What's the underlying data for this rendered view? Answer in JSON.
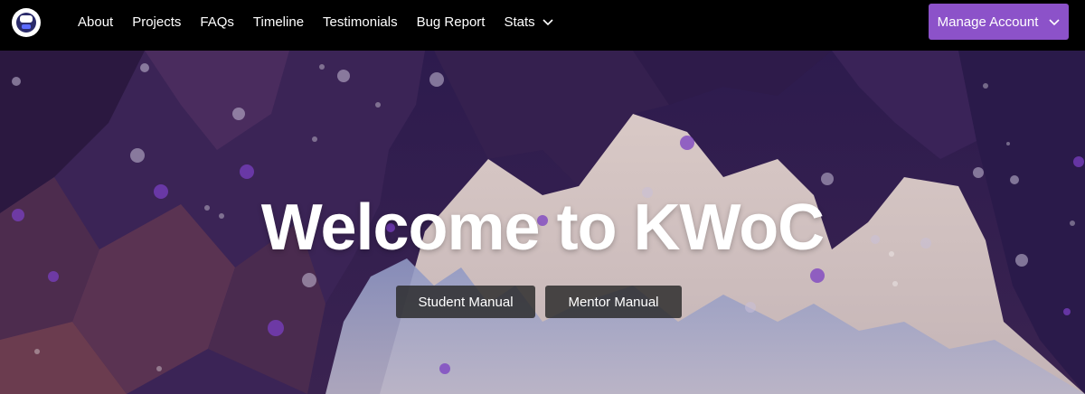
{
  "nav": {
    "logo_icon": "kwoc-logo-icon",
    "links": [
      {
        "label": "About"
      },
      {
        "label": "Projects"
      },
      {
        "label": "FAQs"
      },
      {
        "label": "Timeline"
      },
      {
        "label": "Testimonials"
      },
      {
        "label": "Bug Report"
      },
      {
        "label": "Stats"
      }
    ],
    "stats_dropdown_icon": "chevron-down-icon",
    "manage_account": {
      "label": "Manage Account",
      "icon": "chevron-down-icon",
      "color": "#8c52c9"
    }
  },
  "hero": {
    "title": "Welcome to KWoC",
    "buttons": [
      {
        "label": "Student Manual"
      },
      {
        "label": "Mentor Manual"
      }
    ]
  },
  "colors": {
    "navbar_bg": "#000000",
    "accent": "#8c52c9",
    "hero_bg": "#2a1a4a"
  }
}
